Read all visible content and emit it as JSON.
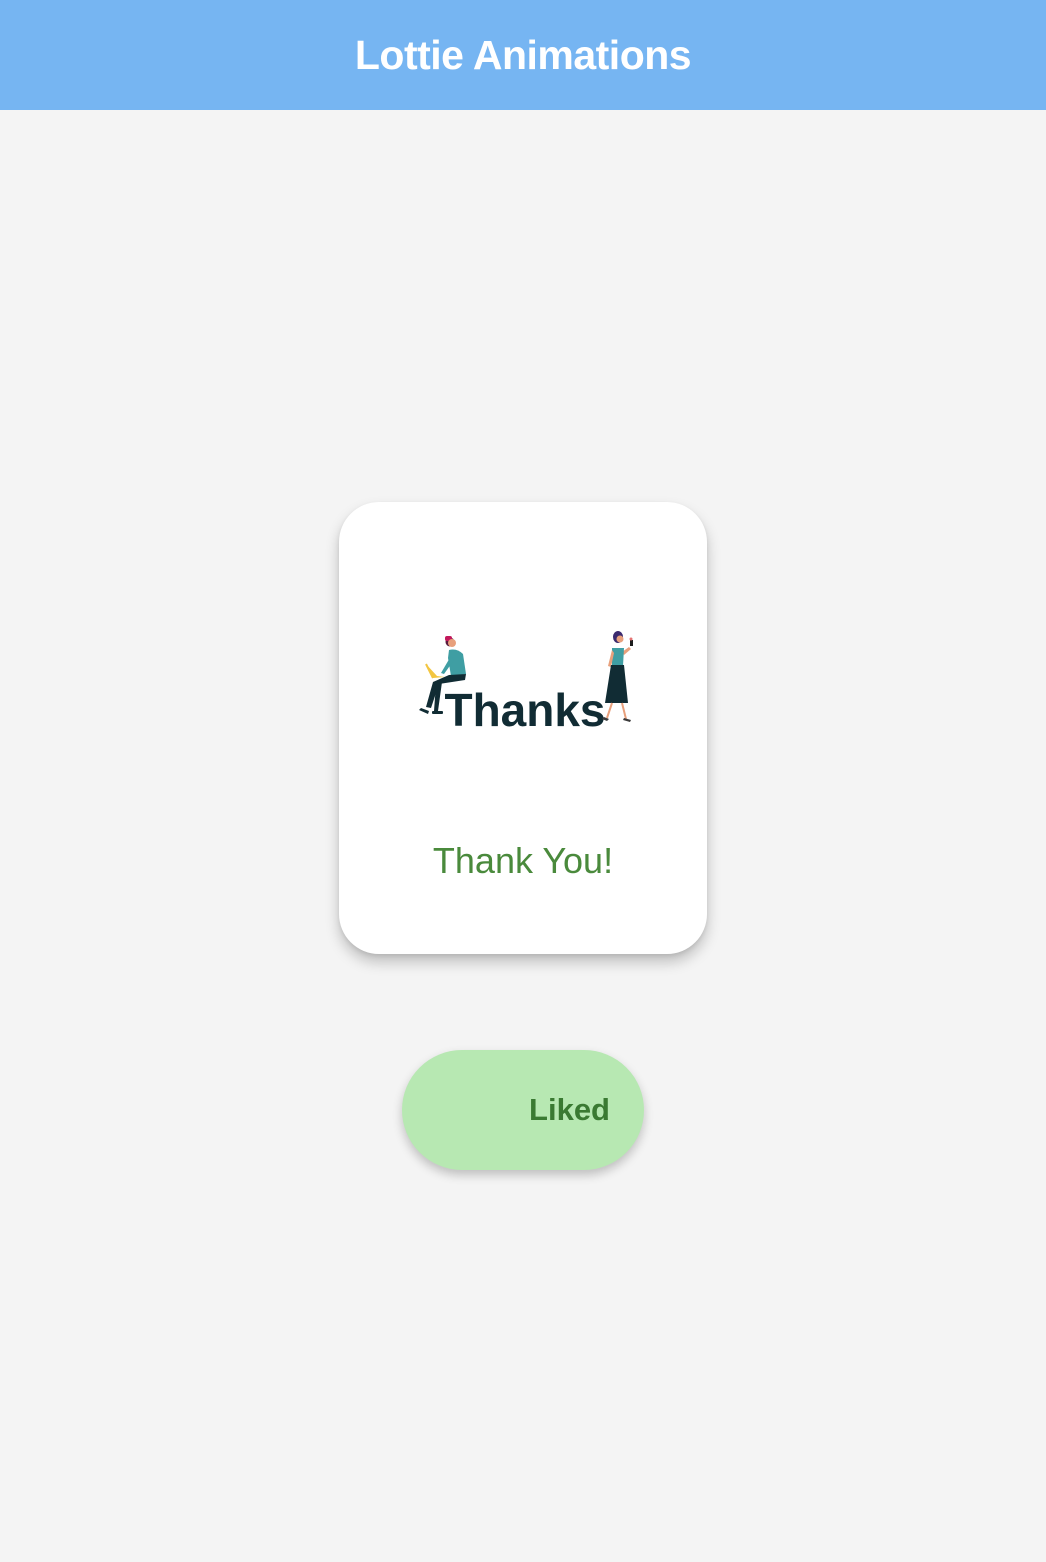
{
  "app_bar": {
    "title": "Lottie Animations",
    "color": "#76b5f2"
  },
  "card": {
    "animation_word": "Thanks",
    "caption": "Thank You!",
    "caption_color": "#4a8a3c"
  },
  "like_button": {
    "label": "Liked",
    "background": "#b7e8b2",
    "text_color": "#3a7a32"
  }
}
